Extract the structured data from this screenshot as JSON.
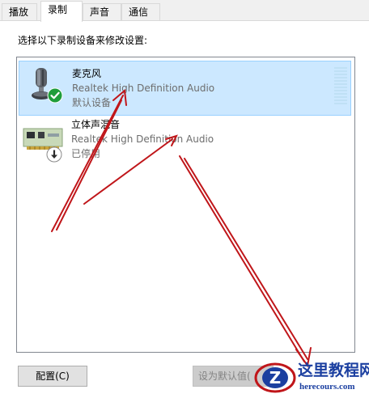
{
  "tabs": [
    {
      "label": "播放",
      "active": false
    },
    {
      "label": "录制",
      "active": true
    },
    {
      "label": "声音",
      "active": false
    },
    {
      "label": "通信",
      "active": false
    }
  ],
  "instruction": "选择以下录制设备来修改设置:",
  "devices": [
    {
      "name": "麦克风",
      "description": "Realtek High Definition Audio",
      "status": "默认设备",
      "icon": "microphone-icon",
      "status_icon": "check-icon",
      "selected": true
    },
    {
      "name": "立体声混音",
      "description": "Realtek High Definition Audio",
      "status": "已停用",
      "icon": "sound-card-icon",
      "status_icon": "disabled-arrow-icon",
      "selected": false
    }
  ],
  "buttons": {
    "configure": "配置(C)",
    "set_default": "设为默认值("
  },
  "watermark": {
    "title": "这里教程网",
    "url": "herecours.com"
  },
  "colors": {
    "selection_bg": "#cce8ff",
    "selection_border": "#99d1ff",
    "annotation_arrow": "#c0161a",
    "default_check": "#1f9d3a",
    "watermark_blue": "#1b3fa0"
  }
}
